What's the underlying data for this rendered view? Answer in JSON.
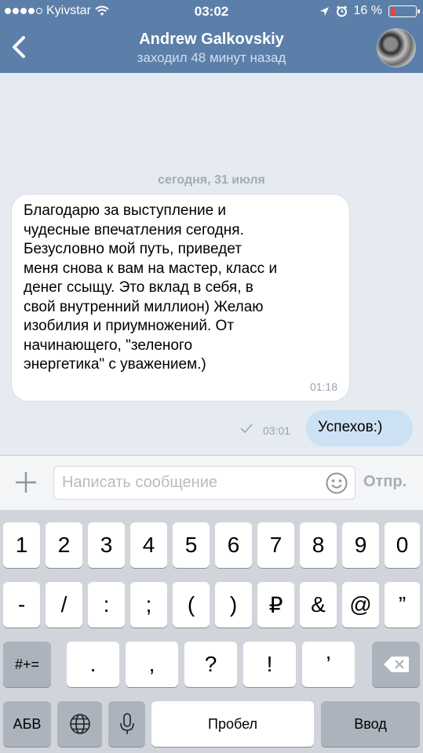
{
  "status_bar": {
    "carrier": "Kyivstar",
    "time": "03:02",
    "battery_text": "16 %",
    "battery_level_percent": 16
  },
  "header": {
    "back_icon": "chevron-left-icon",
    "title": "Andrew Galkovskiy",
    "subtitle": "заходил 48 минут назад"
  },
  "chat": {
    "date_divider": "сегодня, 31 июля",
    "messages": [
      {
        "direction": "in",
        "text": "Благодарю за выступление и\nчудесные впечатления сегодня.\nБезусловно мой путь, приведет\nменя снова к вам на мастер, класс и\nденег ссыщу. Это вклад в себя, в\nсвой внутренний миллион) Желаю\nизобилия и приумножений. От\nначинающего, \"зеленого\nэнергетика\" с уважением.)",
        "time": "01:18"
      },
      {
        "direction": "out",
        "text": "Успехов:)",
        "time": "03:01",
        "status_icon": "checkmark-icon"
      }
    ]
  },
  "composer": {
    "attach_icon": "plus-icon",
    "placeholder": "Написать сообщение",
    "value": "",
    "emoji_icon": "smiley-icon",
    "send_label": "Отпр."
  },
  "keyboard": {
    "row1": [
      "1",
      "2",
      "3",
      "4",
      "5",
      "6",
      "7",
      "8",
      "9",
      "0"
    ],
    "row2": [
      "-",
      "/",
      ":",
      ";",
      "(",
      ")",
      "₽",
      "&",
      "@",
      "”"
    ],
    "row3_mode": "#+=",
    "row3": [
      ".",
      ",",
      "?",
      "!",
      "’"
    ],
    "row3_delete_icon": "backspace-icon",
    "row4": {
      "lang": "АБВ",
      "globe_icon": "globe-icon",
      "mic_icon": "microphone-icon",
      "space": "Пробел",
      "return": "Ввод"
    }
  },
  "colors": {
    "header_bg": "#5b7fa8",
    "chat_bg": "#e5ebf1",
    "outgoing_bubble": "#cde1f5",
    "incoming_bubble": "#ffffff",
    "keyboard_bg": "#d1d5db",
    "battery_low": "#ff3b30"
  }
}
